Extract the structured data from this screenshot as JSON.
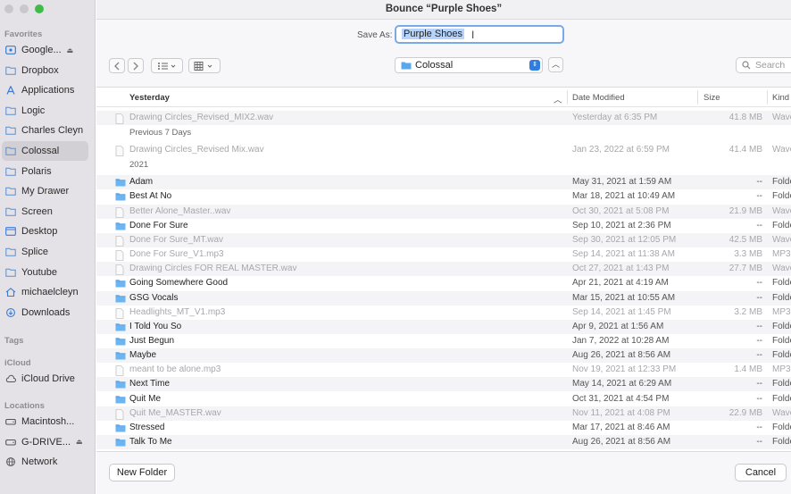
{
  "window": {
    "title": "Bounce “Purple Shoes”"
  },
  "save_as": {
    "label": "Save As:",
    "value": "Purple Shoes"
  },
  "sidebar": {
    "favorites_label": "Favorites",
    "favorites": [
      {
        "label": "Google...",
        "icon": "drive-icon",
        "eject": true
      },
      {
        "label": "Dropbox",
        "icon": "folder-icon"
      },
      {
        "label": "Applications",
        "icon": "applications-icon"
      },
      {
        "label": "Logic",
        "icon": "folder-icon"
      },
      {
        "label": "Charles Cleyn",
        "icon": "folder-icon"
      },
      {
        "label": "Colossal",
        "icon": "folder-icon",
        "active": true
      },
      {
        "label": "Polaris",
        "icon": "folder-icon"
      },
      {
        "label": "My Drawer",
        "icon": "folder-icon"
      },
      {
        "label": "Screen",
        "icon": "folder-icon"
      },
      {
        "label": "Desktop",
        "icon": "desktop-icon"
      },
      {
        "label": "Splice",
        "icon": "folder-icon"
      },
      {
        "label": "Youtube",
        "icon": "folder-icon"
      },
      {
        "label": "michaelcleyn",
        "icon": "home-icon"
      },
      {
        "label": "Downloads",
        "icon": "downloads-icon"
      }
    ],
    "tags_label": "Tags",
    "icloud_label": "iCloud",
    "icloud": [
      {
        "label": "iCloud Drive",
        "icon": "cloud-icon"
      }
    ],
    "locations_label": "Locations",
    "locations": [
      {
        "label": "Macintosh...",
        "icon": "disk-icon"
      },
      {
        "label": "G-DRIVE...",
        "icon": "disk-icon",
        "eject": true
      },
      {
        "label": "Network",
        "icon": "network-icon"
      }
    ]
  },
  "toolbar": {
    "location": "Colossal",
    "search_placeholder": "Search"
  },
  "columns": {
    "name": "Yesterday",
    "date": "Date Modified",
    "size": "Size",
    "kind": "Kind"
  },
  "groups": [
    {
      "label": "Yesterday",
      "rows": [
        {
          "name": "Drawing Circles_Revised_MIX2.wav",
          "date": "Yesterday at 6:35 PM",
          "size": "41.8 MB",
          "kind": "Wave",
          "type": "file"
        }
      ]
    },
    {
      "label": "Previous 7 Days",
      "rows": [
        {
          "name": "Drawing Circles_Revised Mix.wav",
          "date": "Jan 23, 2022 at 6:59 PM",
          "size": "41.4 MB",
          "kind": "Wave",
          "type": "file"
        }
      ]
    },
    {
      "label": "2021",
      "rows": [
        {
          "name": "Adam",
          "date": "May 31, 2021 at 1:59 AM",
          "size": "--",
          "kind": "Folde",
          "type": "folder"
        },
        {
          "name": "Best At No",
          "date": "Mar 18, 2021 at 10:49 AM",
          "size": "--",
          "kind": "Folde",
          "type": "folder"
        },
        {
          "name": "Better Alone_Master..wav",
          "date": "Oct 30, 2021 at 5:08 PM",
          "size": "21.9 MB",
          "kind": "Wave",
          "type": "file"
        },
        {
          "name": "Done For Sure",
          "date": "Sep 10, 2021 at 2:36 PM",
          "size": "--",
          "kind": "Folde",
          "type": "folder"
        },
        {
          "name": "Done For Sure_MT.wav",
          "date": "Sep 30, 2021 at 12:05 PM",
          "size": "42.5 MB",
          "kind": "Wave",
          "type": "file"
        },
        {
          "name": "Done For Sure_V1.mp3",
          "date": "Sep 14, 2021 at 11:38 AM",
          "size": "3.3 MB",
          "kind": "MP3",
          "type": "file"
        },
        {
          "name": "Drawing Circles FOR REAL MASTER.wav",
          "date": "Oct 27, 2021 at 1:43 PM",
          "size": "27.7 MB",
          "kind": "Wave",
          "type": "file"
        },
        {
          "name": "Going Somewhere Good",
          "date": "Apr 21, 2021 at 4:19 AM",
          "size": "--",
          "kind": "Folde",
          "type": "folder"
        },
        {
          "name": "GSG Vocals",
          "date": "Mar 15, 2021 at 10:55 AM",
          "size": "--",
          "kind": "Folde",
          "type": "folder"
        },
        {
          "name": "Headlights_MT_V1.mp3",
          "date": "Sep 14, 2021 at 1:45 PM",
          "size": "3.2 MB",
          "kind": "MP3",
          "type": "file"
        },
        {
          "name": "I Told You So",
          "date": "Apr 9, 2021 at 1:56 AM",
          "size": "--",
          "kind": "Folde",
          "type": "folder"
        },
        {
          "name": "Just Begun",
          "date": "Jan 7, 2022 at 10:28 AM",
          "size": "--",
          "kind": "Folde",
          "type": "folder"
        },
        {
          "name": "Maybe",
          "date": "Aug 26, 2021 at 8:56 AM",
          "size": "--",
          "kind": "Folde",
          "type": "folder"
        },
        {
          "name": "meant to be alone.mp3",
          "date": "Nov 19, 2021 at 12:33 PM",
          "size": "1.4 MB",
          "kind": "MP3",
          "type": "file"
        },
        {
          "name": "Next Time",
          "date": "May 14, 2021 at 6:29 AM",
          "size": "--",
          "kind": "Folde",
          "type": "folder"
        },
        {
          "name": "Quit Me",
          "date": "Oct 31, 2021 at 4:54 PM",
          "size": "--",
          "kind": "Folde",
          "type": "folder"
        },
        {
          "name": "Quit Me_MASTER.wav",
          "date": "Nov 11, 2021 at 4:08 PM",
          "size": "22.9 MB",
          "kind": "Wave",
          "type": "file"
        },
        {
          "name": "Stressed",
          "date": "Mar 17, 2021 at 8:46 AM",
          "size": "--",
          "kind": "Folde",
          "type": "folder"
        },
        {
          "name": "Talk To Me",
          "date": "Aug 26, 2021 at 8:56 AM",
          "size": "--",
          "kind": "Folde",
          "type": "folder"
        }
      ]
    }
  ],
  "buttons": {
    "new_folder": "New Folder",
    "cancel": "Cancel"
  },
  "colors": {
    "accent": "#2f7de1",
    "folder": "#5ba7ec",
    "selection": "#b5d3fb"
  }
}
